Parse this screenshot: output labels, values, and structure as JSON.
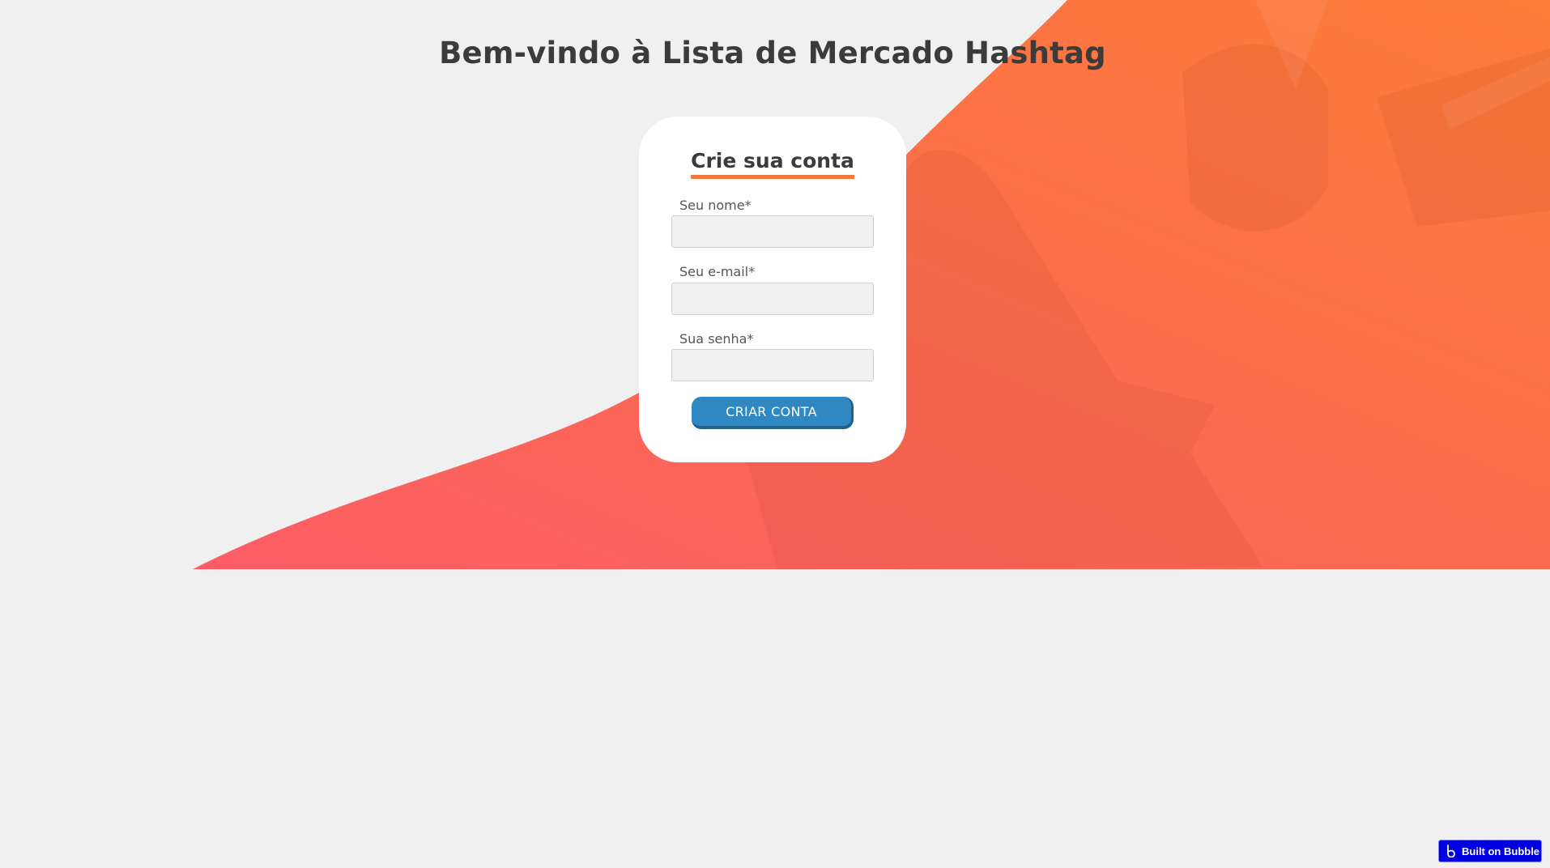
{
  "page": {
    "title": "Bem-vindo à Lista de Mercado Hashtag"
  },
  "signup_card": {
    "heading": "Crie sua conta",
    "fields": [
      {
        "label": "Seu nome*",
        "value": "",
        "placeholder": ""
      },
      {
        "label": "Seu e-mail*",
        "value": "",
        "placeholder": ""
      },
      {
        "label": "Sua senha*",
        "value": "",
        "placeholder": ""
      }
    ],
    "submit_label": "CRIAR CONTA"
  },
  "badge": {
    "label": "Built on Bubble",
    "icon": "bubble-logo-icon"
  },
  "colors": {
    "background": "#f1f0f0",
    "hero_gradient_start": "#fd5c65",
    "hero_gradient_end": "#fd7c38",
    "heading_underline": "#f47a3c",
    "button": "#3088c2",
    "badge": "#0000e0",
    "title_text": "#3b3b3b"
  }
}
